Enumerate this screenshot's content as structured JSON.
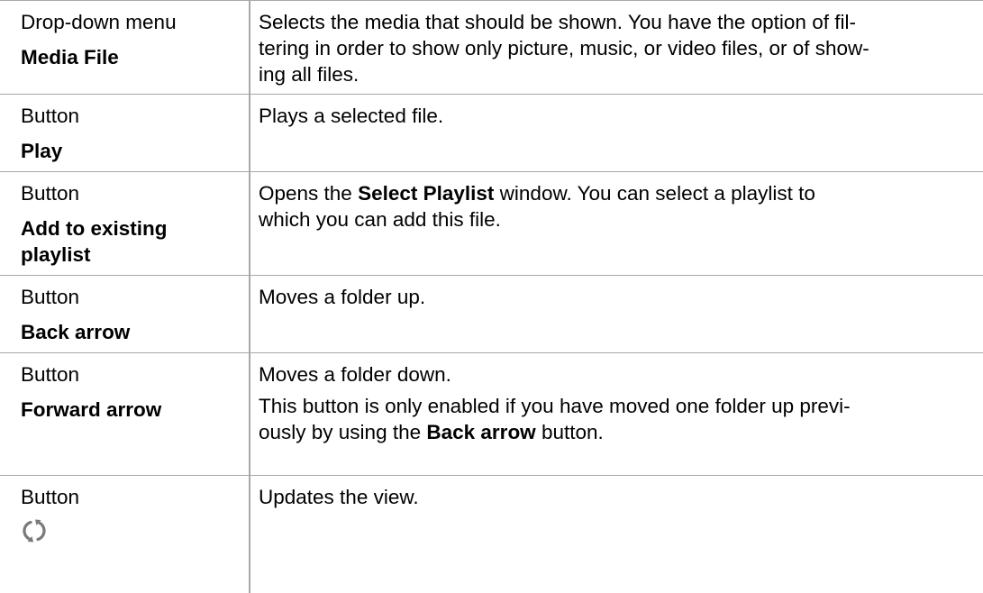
{
  "rows": [
    {
      "type": "Drop-down menu",
      "name": "Media File",
      "description": "Selects the media that should be shown. You have the option of fil-\nter­ing in order to show only picture, music, or video files, or of show-\ning all files."
    },
    {
      "type": "Button",
      "name": "Play",
      "description": "Plays a selected file."
    },
    {
      "type": "Button",
      "name_line1": "Add to existing",
      "name_line2": "playlist",
      "desc_pre": "Opens the ",
      "desc_bold": "Select Playlist",
      "desc_post": " window. You can select a playlist to",
      "desc_line2": "which you can add this file."
    },
    {
      "type": "Button",
      "name": "Back arrow",
      "description": "Moves a folder up."
    },
    {
      "type": "Button",
      "name": "Forward arrow",
      "description": "Moves a folder down.",
      "note_line1": "This button is only enabled if you have moved one folder up previ-",
      "note_pre": "ously by using the ",
      "note_bold": "Back arrow",
      "note_post": " button."
    },
    {
      "type": "Button",
      "icon": "refresh-icon",
      "description": "Updates the view."
    }
  ],
  "colors": {
    "rule": "#a8a8a8",
    "icon": "#7a7a7a"
  }
}
